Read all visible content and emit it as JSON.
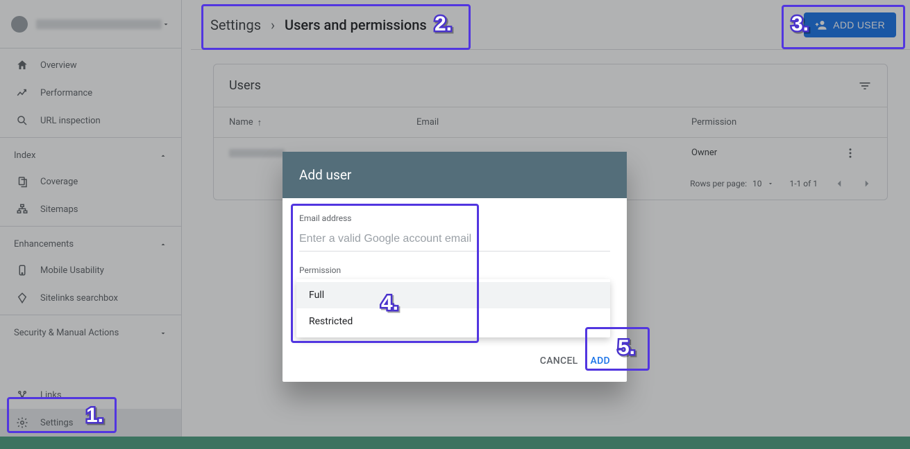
{
  "sidebar": {
    "items": [
      {
        "label": "Overview"
      },
      {
        "label": "Performance"
      },
      {
        "label": "URL inspection"
      }
    ],
    "section_index_label": "Index",
    "index_items": [
      {
        "label": "Coverage"
      },
      {
        "label": "Sitemaps"
      }
    ],
    "section_enh_label": "Enhancements",
    "enh_items": [
      {
        "label": "Mobile Usability"
      },
      {
        "label": "Sitelinks searchbox"
      }
    ],
    "section_sec_label": "Security & Manual Actions",
    "links_label": "Links",
    "settings_label": "Settings"
  },
  "breadcrumb": {
    "root": "Settings",
    "chev": "›",
    "current": "Users and permissions"
  },
  "add_user_button": "ADD USER",
  "users_card": {
    "title": "Users",
    "columns": {
      "name": "Name",
      "email": "Email",
      "permission": "Permission"
    },
    "row0_permission": "Owner",
    "footer": {
      "rpp_label": "Rows per page:",
      "rpp_value": "10",
      "range": "1-1 of 1"
    }
  },
  "modal": {
    "title": "Add user",
    "email_label": "Email address",
    "email_placeholder": "Enter a valid Google account email",
    "perm_label": "Permission",
    "options": {
      "full": "Full",
      "restricted": "Restricted"
    },
    "cancel": "CANCEL",
    "add": "ADD"
  },
  "annotations": {
    "b1": "1.",
    "b2": "2.",
    "b3": "3.",
    "b4": "4.",
    "b5": "5."
  }
}
